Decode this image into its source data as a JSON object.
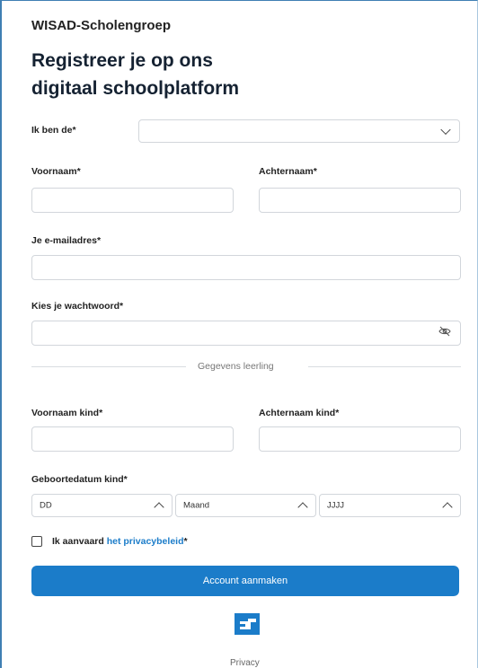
{
  "brand": "WISAD-Scholengroep",
  "title_line1": "Registreer je op ons",
  "title_line2": "digitaal schoolplatform",
  "role": {
    "label": "Ik ben de*",
    "value": ""
  },
  "firstname": {
    "label": "Voornaam*",
    "value": ""
  },
  "lastname": {
    "label": "Achternaam*",
    "value": ""
  },
  "email": {
    "label": "Je e-mailadres*",
    "value": ""
  },
  "password": {
    "label": "Kies je wachtwoord*",
    "value": ""
  },
  "divider": "Gegevens leerling",
  "child_firstname": {
    "label": "Voornaam kind*",
    "value": ""
  },
  "child_lastname": {
    "label": "Achternaam kind*",
    "value": ""
  },
  "birthdate": {
    "label": "Geboortedatum kind*",
    "day": "DD",
    "month": "Maand",
    "year": "JJJJ"
  },
  "consent": {
    "prefix": "Ik aanvaard ",
    "link": "het privacybeleid",
    "suffix": "*"
  },
  "submit": "Account aanmaken",
  "privacy_link": "Privacy",
  "colors": {
    "accent": "#1b7cc9",
    "frame": "#3f7fb3"
  }
}
